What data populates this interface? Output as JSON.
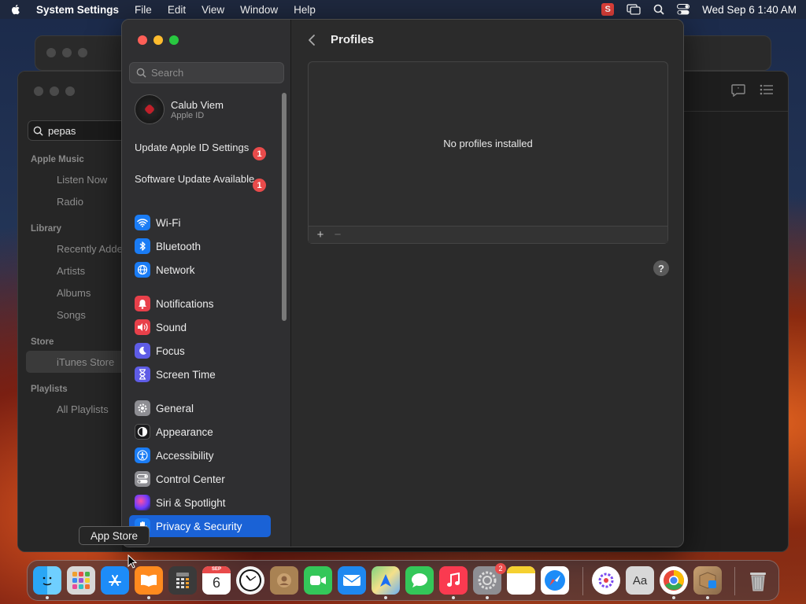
{
  "menubar": {
    "app_name": "System Settings",
    "menus": [
      "File",
      "Edit",
      "View",
      "Window",
      "Help"
    ],
    "datetime": "Wed Sep 6  1:40 AM",
    "status_s": "S"
  },
  "music": {
    "search_value": "pepas",
    "sections": {
      "apple_music": "Apple Music",
      "library": "Library",
      "store": "Store",
      "playlists": "Playlists"
    },
    "items": {
      "listen_now": "Listen Now",
      "radio": "Radio",
      "recently_added": "Recently Added",
      "artists": "Artists",
      "albums": "Albums",
      "songs": "Songs",
      "itunes_store": "iTunes Store",
      "all_playlists": "All Playlists"
    }
  },
  "settings": {
    "search_placeholder": "Search",
    "account": {
      "name": "Calub Viem",
      "sub": "Apple ID"
    },
    "notices": [
      {
        "label": "Update Apple ID Settings",
        "badge": "1"
      },
      {
        "label": "Software Update Available",
        "badge": "1"
      }
    ],
    "nav": {
      "wifi": "Wi-Fi",
      "bluetooth": "Bluetooth",
      "network": "Network",
      "notifications": "Notifications",
      "sound": "Sound",
      "focus": "Focus",
      "screen_time": "Screen Time",
      "general": "General",
      "appearance": "Appearance",
      "accessibility": "Accessibility",
      "control_center": "Control Center",
      "siri": "Siri & Spotlight",
      "privacy": "Privacy & Security"
    },
    "page_title": "Profiles",
    "empty_text": "No profiles installed",
    "add_label": "+",
    "remove_label": "−",
    "help_label": "?"
  },
  "tooltip": "App Store",
  "dock": {
    "calendar_month": "SEP",
    "calendar_day": "6",
    "system_settings_badge": "2",
    "dictionary_label": "Aa"
  },
  "colors": {
    "accent": "#1a62d6",
    "badge": "#e94b4b"
  }
}
